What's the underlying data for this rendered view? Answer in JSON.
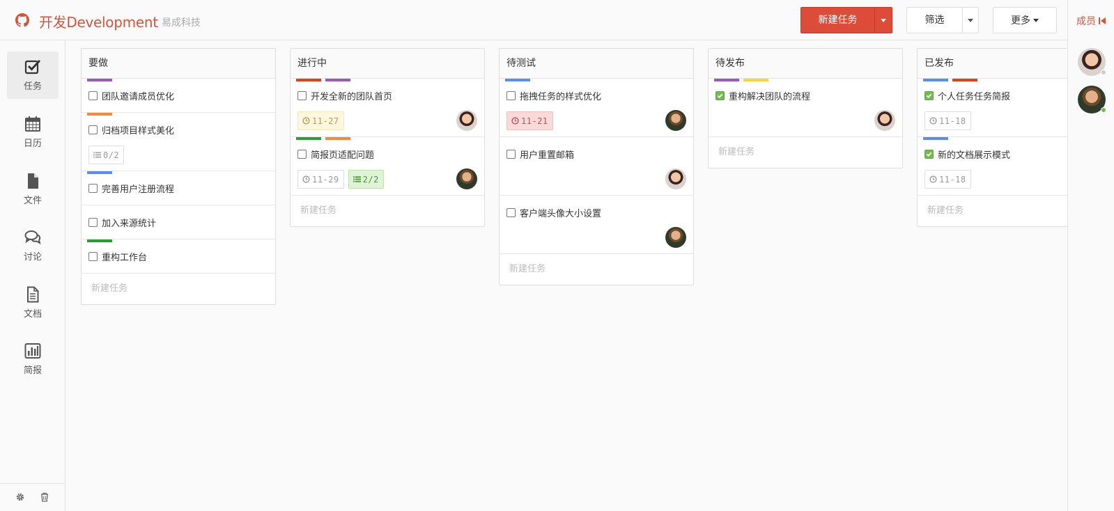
{
  "header": {
    "project_title": "开发Development",
    "org_name": "易成科技",
    "new_task_label": "新建任务",
    "filter_label": "筛选",
    "more_label": "更多"
  },
  "members_panel": {
    "label": "成员",
    "members": [
      {
        "avatar": "avatar-male-red",
        "status_color": "#cccccc"
      },
      {
        "avatar": "avatar-male-green",
        "status_color": "#6dbf4a"
      }
    ]
  },
  "nav": {
    "items": [
      {
        "label": "任务",
        "icon": "task-check-icon",
        "active": true
      },
      {
        "label": "日历",
        "icon": "calendar-icon"
      },
      {
        "label": "文件",
        "icon": "file-icon"
      },
      {
        "label": "讨论",
        "icon": "comments-icon"
      },
      {
        "label": "文档",
        "icon": "document-icon"
      },
      {
        "label": "简报",
        "icon": "bar-chart-icon"
      }
    ],
    "footer_icons": [
      "gear-icon",
      "trash-icon"
    ]
  },
  "colors": {
    "accent": "#dd4b39",
    "tag_purple": "#9b59b6",
    "tag_orange": "#f0883e",
    "tag_blue": "#5b8ee6",
    "tag_green": "#2a9d3a",
    "tag_red": "#d9431e",
    "tag_yellow": "#f5d63c"
  },
  "columns": [
    {
      "title": "要做",
      "new_task": "新建任务",
      "cards": [
        {
          "title": "团队邀请成员优化",
          "tags": [
            "#9b59b6"
          ]
        },
        {
          "title": "归档项目样式美化",
          "tags": [
            "#f0883e"
          ],
          "checklist": "0/2"
        },
        {
          "title": "完善用户注册流程",
          "tags": [
            "#5b8ee6"
          ]
        },
        {
          "title": "加入来源统计",
          "tags": []
        },
        {
          "title": "重构工作台",
          "tags": [
            "#2a9d3a"
          ]
        }
      ]
    },
    {
      "title": "进行中",
      "new_task": "新建任务",
      "cards": [
        {
          "title": "开发全新的团队首页",
          "tags": [
            "#d9431e",
            "#9b59b6"
          ],
          "due": "11-27",
          "due_state": "warn",
          "assignee": "avatar-male-red"
        },
        {
          "title": "简报页适配问题",
          "tags": [
            "#2a9d3a",
            "#f0883e"
          ],
          "due": "11-29",
          "due_state": "normal",
          "checklist": "2/2",
          "assignee": "avatar-male-green"
        }
      ]
    },
    {
      "title": "待测试",
      "new_task": "新建任务",
      "cards": [
        {
          "title": "拖拽任务的样式优化",
          "tags": [
            "#5b8ee6"
          ],
          "due": "11-21",
          "due_state": "over",
          "assignee": "avatar-male-green"
        },
        {
          "title": "用户重置邮箱",
          "tags": [],
          "assignee": "avatar-male-red"
        },
        {
          "title": "客户端头像大小设置",
          "tags": [],
          "assignee": "avatar-male-green"
        }
      ]
    },
    {
      "title": "待发布",
      "new_task": "新建任务",
      "cards": [
        {
          "title": "重构解决团队的流程",
          "tags": [
            "#9b59b6",
            "#f5d63c"
          ],
          "checked": true,
          "assignee": "avatar-male-red"
        }
      ]
    },
    {
      "title": "已发布",
      "new_task": "新建任务",
      "cards": [
        {
          "title": "个人任务任务简报",
          "tags": [
            "#5b8ee6",
            "#d9431e"
          ],
          "checked": true,
          "due": "11-18",
          "due_state": "normal"
        },
        {
          "title": "新的文档展示模式",
          "tags": [
            "#5b8ee6"
          ],
          "checked": true,
          "due": "11-18",
          "due_state": "normal"
        }
      ]
    }
  ]
}
